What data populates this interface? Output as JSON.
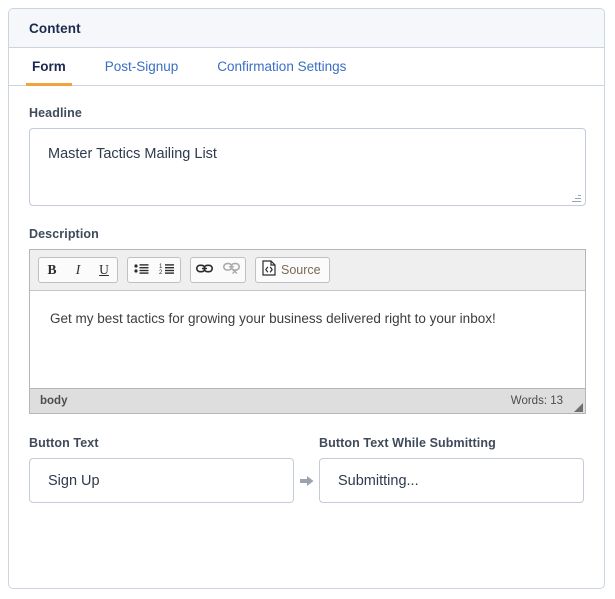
{
  "card": {
    "header_title": "Content"
  },
  "tabs": [
    {
      "label": "Form",
      "active": true
    },
    {
      "label": "Post-Signup",
      "active": false
    },
    {
      "label": "Confirmation Settings",
      "active": false
    }
  ],
  "headline": {
    "label": "Headline",
    "value": "Master Tactics Mailing List"
  },
  "description": {
    "label": "Description",
    "toolbar": {
      "bold": "B",
      "italic": "I",
      "underline": "U",
      "bulleted_list_icon": "bulleted-list-icon",
      "numbered_list_icon": "numbered-list-icon",
      "link_icon": "link-icon",
      "unlink_icon": "unlink-icon",
      "source_icon": "source-code-icon",
      "source_label": "Source"
    },
    "content": "Get my best tactics for growing your business delivered right to your inbox!",
    "status": {
      "element_path": "body",
      "word_count": "Words: 13"
    }
  },
  "button_text": {
    "label": "Button Text",
    "value": "Sign Up"
  },
  "button_text_submitting": {
    "label": "Button Text While Submitting",
    "value": "Submitting...",
    "separator_icon": "arrow-right-icon"
  },
  "colors": {
    "accent_orange": "#f2a33c",
    "link_blue": "#3a6fc4",
    "heading_navy": "#1b2a4e",
    "border": "#ccd4e0",
    "header_bg": "#f5f7fa"
  }
}
